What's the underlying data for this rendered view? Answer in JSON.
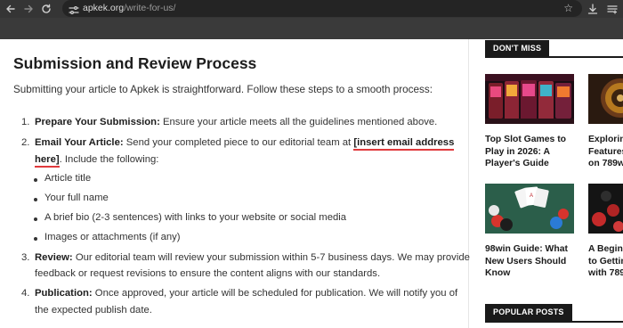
{
  "browser": {
    "url_host": "apkek.org",
    "url_path": "/write-for-us/"
  },
  "article": {
    "heading": "Submission and Review Process",
    "intro": "Submitting your article to Apkek is straightforward. Follow these steps to a smooth process:",
    "steps": [
      {
        "number": "1.",
        "title": "Prepare Your Submission:",
        "text": " Ensure your article meets all the guidelines mentioned above."
      },
      {
        "number": "2.",
        "title": "Email Your Article:",
        "text": " Send your completed piece to our editorial team at ",
        "link_part1": "[insert email address",
        "link_part2": "here]",
        "text_after": ". Include the following:",
        "bullets": [
          "Article title",
          "Your full name",
          "A brief bio (2-3 sentences) with links to your website or social media",
          "Images or attachments (if any)"
        ]
      },
      {
        "number": "3.",
        "title": "Review:",
        "text": " Our editorial team will review your submission within 5-7 business days. We may provide",
        "text2": "feedback or request revisions to ensure the content aligns with our standards."
      },
      {
        "number": "4.",
        "title": "Publication:",
        "text": " Once approved, your article will be scheduled for publication. We will notify you of",
        "text2": "the expected publish date."
      }
    ]
  },
  "sidebar": {
    "dont_miss_label": "DON'T MISS",
    "popular_label": "POPULAR POSTS",
    "posts": [
      {
        "lines": [
          "Top Slot Games to",
          "Play in 2026: A",
          "Player's Guide"
        ]
      },
      {
        "lines": [
          "Explorin",
          "Features",
          "on 789w"
        ]
      },
      {
        "lines": [
          "98win Guide: What",
          "New Users Should",
          "Know"
        ]
      },
      {
        "lines": [
          "A Beginn",
          "to Gettin",
          "with 789"
        ]
      }
    ]
  },
  "colors": {
    "chrome_bg": "#353535",
    "omnibox_bg": "#242424",
    "site_header": "#3a3a3a",
    "highlight_underline": "#e0393c",
    "section_tag": "#1a1a1a"
  },
  "icons": [
    "back-arrow-icon",
    "forward-arrow-icon",
    "reload-icon",
    "site-tune-icon",
    "bookmark-star-icon",
    "download-icon",
    "reading-list-icon"
  ]
}
